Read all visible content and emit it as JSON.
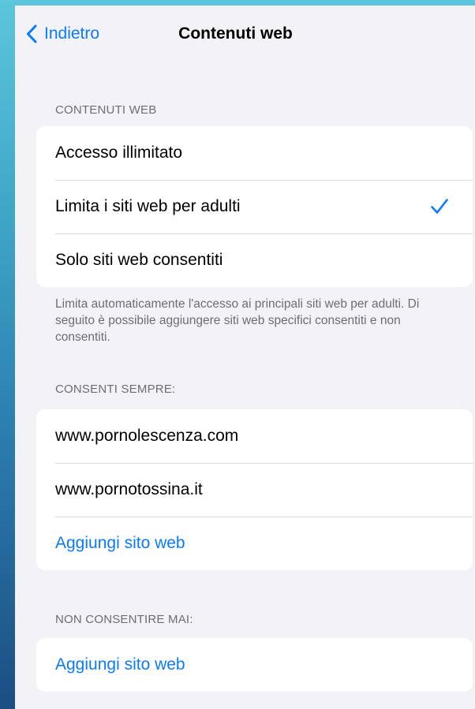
{
  "nav": {
    "back_label": "Indietro",
    "title": "Contenuti web"
  },
  "web_content": {
    "header": "CONTENUTI WEB",
    "options": [
      {
        "label": "Accesso illimitato",
        "selected": false
      },
      {
        "label": "Limita i siti web per adulti",
        "selected": true
      },
      {
        "label": "Solo siti web consentiti",
        "selected": false
      }
    ],
    "footer": "Limita automaticamente l'accesso ai principali siti web per adulti. Di seguito è possibile aggiungere siti web specifici consentiti e non consentiti."
  },
  "always_allow": {
    "header": "CONSENTI SEMPRE:",
    "sites": [
      "www.pornolescenza.com",
      "www.pornotossina.it"
    ],
    "add_label": "Aggiungi sito web"
  },
  "never_allow": {
    "header": "NON CONSENTIRE MAI:",
    "add_label": "Aggiungi sito web"
  },
  "colors": {
    "accent": "#0a7aff",
    "background": "#f2f2f7",
    "secondary_text": "#6d6d72"
  },
  "icons": {
    "back": "chevron-left-icon",
    "selected": "checkmark-icon"
  }
}
